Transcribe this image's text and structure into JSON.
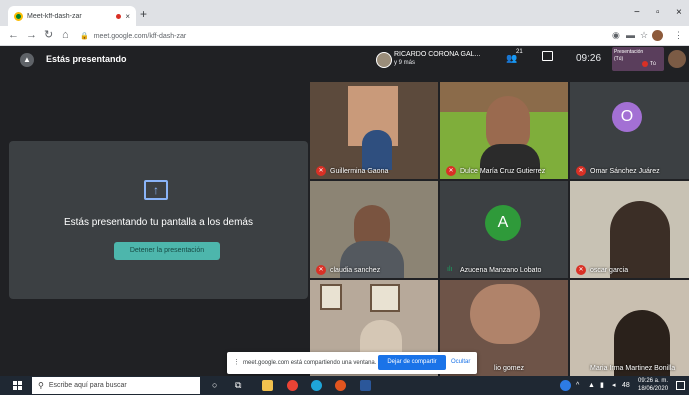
{
  "browser": {
    "tab_title": "Meet-kff-dash-zar",
    "tab_close": "×",
    "new_tab": "+",
    "url": "meet.google.com/kff-dash-zar",
    "window_min": "−",
    "window_max": "▫",
    "window_close": "×"
  },
  "meet": {
    "presenting_title": "Estás presentando",
    "pinned_name": "RICARDO CORONA GAL...",
    "pinned_more": "y 9 más",
    "participant_count": "21",
    "time": "09:26",
    "self_label": "Presentación",
    "self_count": "(Tú)",
    "self_you": "Tú",
    "card_message": "Estás presentando tu pantalla a los demás",
    "stop_button": "Detener la presentación",
    "participants": [
      {
        "name": "Guillermina Gaona",
        "muted": true
      },
      {
        "name": "Dulce María Cruz Gutierrez",
        "muted": true
      },
      {
        "name": "Omar Sánchez Juárez",
        "muted": true,
        "initial": "O"
      },
      {
        "name": "claudia sanchez",
        "muted": true
      },
      {
        "name": "Azucena Manzano Lobato",
        "muted": false,
        "initial": "A"
      },
      {
        "name": "oscar garcia",
        "muted": true
      },
      {
        "name": "",
        "muted": false
      },
      {
        "name": "lio gomez",
        "muted": false
      },
      {
        "name": "Maria Irma Martinez Bonilla",
        "muted": false
      }
    ],
    "colors": {
      "bg": "#202124",
      "accent": "#4db6ac",
      "mute": "#d93025",
      "omar": "#a370d4",
      "azucena": "#2f9a3a"
    }
  },
  "share_bar": {
    "message": "meet.google.com está compartiendo una ventana.",
    "stop": "Dejar de compartir",
    "hide": "Ocultar"
  },
  "taskbar": {
    "search_placeholder": "Escribe aquí para buscar",
    "time": "09:26 a. m.",
    "date": "18/06/2020",
    "lang": "48"
  }
}
